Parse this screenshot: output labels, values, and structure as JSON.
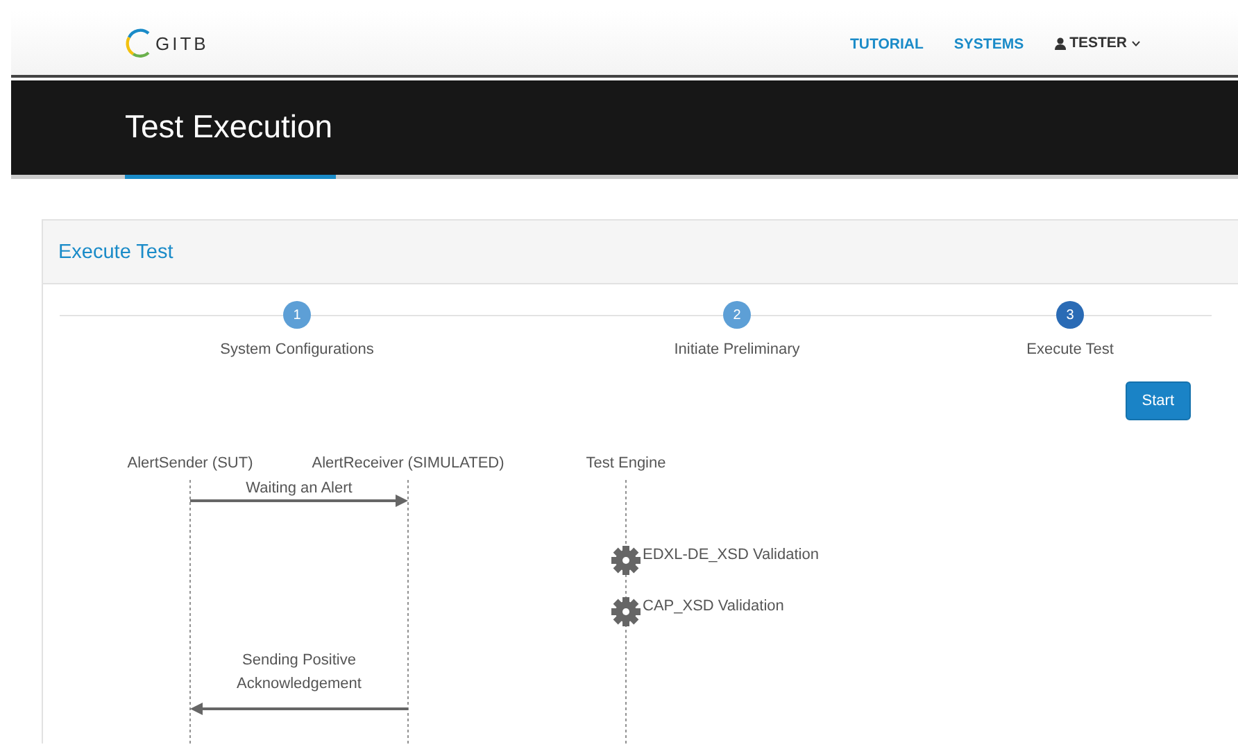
{
  "navbar": {
    "logo": "GITB",
    "links": [
      {
        "label": "TUTORIAL"
      },
      {
        "label": "SYSTEMS"
      }
    ],
    "user": "TESTER"
  },
  "page_title": "Test Execution",
  "panel": {
    "title": "Execute Test",
    "steps": [
      {
        "number": "1",
        "label": "System Configurations",
        "selected": false
      },
      {
        "number": "2",
        "label": "Initiate Preliminary",
        "selected": false
      },
      {
        "number": "3",
        "label": "Execute Test",
        "selected": true
      }
    ],
    "start_button": "Start",
    "diagram": {
      "actors": [
        {
          "name": "AlertSender (SUT)"
        },
        {
          "name": "AlertReceiver (SIMULATED)"
        },
        {
          "name": "Test Engine"
        }
      ],
      "events": [
        {
          "kind": "request",
          "label": "Waiting an Alert"
        },
        {
          "kind": "validation",
          "label": "EDXL-DE_XSD Validation"
        },
        {
          "kind": "validation",
          "label": "CAP_XSD Validation"
        },
        {
          "kind": "response",
          "label": "Sending Positive Acknowledgement"
        }
      ]
    }
  }
}
